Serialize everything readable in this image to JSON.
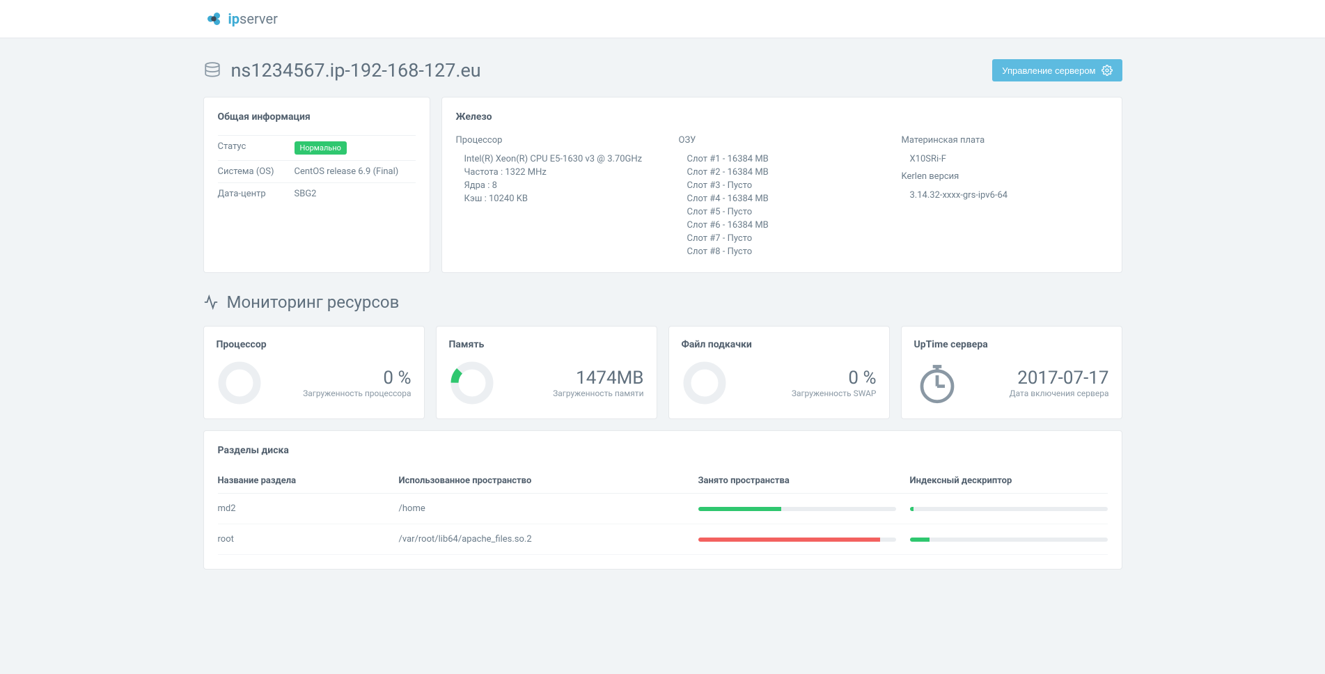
{
  "brand": {
    "ip": "ip",
    "server": "server"
  },
  "page": {
    "hostname": "ns1234567.ip-192-168-127.eu",
    "manageBtn": "Управление сервером"
  },
  "info": {
    "title": "Общая информация",
    "rows": {
      "statusLabel": "Статус",
      "statusBadge": "Нормально",
      "osLabel": "Система (OS)",
      "osVal": "CentOS release 6.9 (Final)",
      "dcLabel": "Дата-центр",
      "dcVal": "SBG2"
    }
  },
  "hw": {
    "title": "Железо",
    "cpu": {
      "h": "Процессор",
      "l1": "Intel(R) Xeon(R) CPU E5-1630 v3 @ 3.70GHz",
      "l2": "Частота : 1322 MHz",
      "l3": "Ядра : 8",
      "l4": "Кэш : 10240 KB"
    },
    "ram": {
      "h": "ОЗУ",
      "l1": "Слот #1 - 16384 MB",
      "l2": "Слот #2 - 16384 MB",
      "l3": "Слот #3 - Пусто",
      "l4": "Слот #4 - 16384 MB",
      "l5": "Слот #5 - Пусто",
      "l6": "Слот #6 - 16384 MB",
      "l7": "Слот #7 - Пусто",
      "l8": "Слот #8 - Пусто"
    },
    "mb": {
      "h": "Материнская плата",
      "l1": "X10SRi-F",
      "kh": "Kerlen версия",
      "kl": "3.14.32-xxxx-grs-ipv6-64"
    }
  },
  "mon": {
    "title": "Мониторинг ресурсов",
    "cpu": {
      "t": "Процессор",
      "v": "0 %",
      "l": "Загруженность процессора",
      "pct": 0
    },
    "mem": {
      "t": "Память",
      "v": "1474MB",
      "l": "Загруженность памяти",
      "pct": 12
    },
    "swap": {
      "t": "Файл подкачки",
      "v": "0 %",
      "l": "Загруженность SWAP",
      "pct": 0
    },
    "up": {
      "t1": "UpTime",
      "t2": " сервера",
      "v": "2017-07-17",
      "l": "Дата включения сервера"
    }
  },
  "disk": {
    "title": "Разделы диска",
    "cols": {
      "name": "Название раздела",
      "used": "Использованное пространство",
      "space": "Занято пространства",
      "inode": "Индексный дескриптор"
    },
    "rows": [
      {
        "name": "md2",
        "used": "/home",
        "space": 42,
        "spaceColor": "green",
        "inode": 2
      },
      {
        "name": "root",
        "used": "/var/root/lib64/apache_files.so.2",
        "space": 92,
        "spaceColor": "red",
        "inode": 10
      }
    ]
  },
  "chart_data": [
    {
      "type": "pie",
      "title": "Процессор",
      "values": [
        0,
        100
      ],
      "categories": [
        "used",
        "free"
      ]
    },
    {
      "type": "pie",
      "title": "Память",
      "values": [
        12,
        88
      ],
      "categories": [
        "used",
        "free"
      ]
    },
    {
      "type": "pie",
      "title": "Файл подкачки",
      "values": [
        0,
        100
      ],
      "categories": [
        "used",
        "free"
      ]
    },
    {
      "type": "bar",
      "title": "Разделы диска - Занято",
      "categories": [
        "md2",
        "root"
      ],
      "values": [
        42,
        92
      ]
    },
    {
      "type": "bar",
      "title": "Разделы диска - Дескриптор",
      "categories": [
        "md2",
        "root"
      ],
      "values": [
        2,
        10
      ]
    }
  ]
}
